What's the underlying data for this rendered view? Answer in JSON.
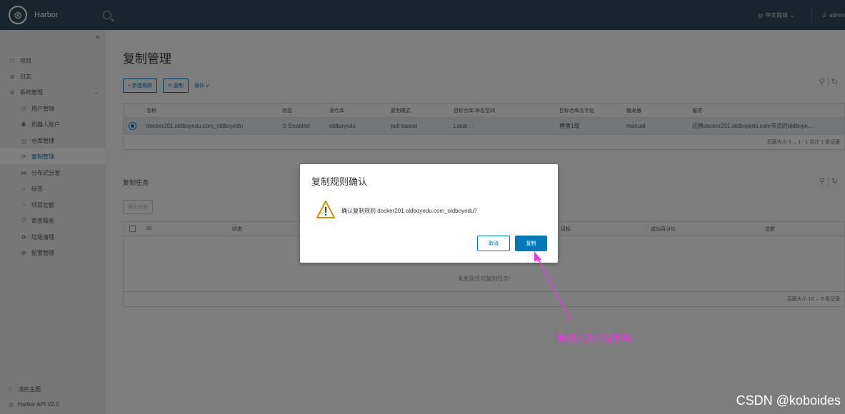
{
  "header": {
    "app_name": "Harbor",
    "language": "中文简体 ⌄",
    "user": "admin"
  },
  "sidebar": {
    "collapse": "«",
    "items": [
      {
        "label": "项目",
        "icon": "⚇"
      },
      {
        "label": "日志",
        "icon": "≣"
      },
      {
        "label": "系统管理",
        "icon": "⚙"
      },
      {
        "label": "用户管理",
        "icon": "⚇"
      },
      {
        "label": "机器人账户",
        "icon": "⚉"
      },
      {
        "label": "仓库管理",
        "icon": "◫"
      },
      {
        "label": "复制管理",
        "icon": "⟳"
      },
      {
        "label": "分布式分发",
        "icon": "⋈"
      },
      {
        "label": "标签",
        "icon": "⌂"
      },
      {
        "label": "项目定额",
        "icon": "◔"
      },
      {
        "label": "审查服务",
        "icon": "⛉"
      },
      {
        "label": "垃圾清理",
        "icon": "♻"
      },
      {
        "label": "配置管理",
        "icon": "⚙"
      }
    ],
    "theme": "浅色主题",
    "api": "Harbor API V2.0"
  },
  "main": {
    "title": "复制管理",
    "new_rule": "+ 新建规则",
    "replicate": "⟳ 复制",
    "ops": "操作 ∨",
    "rules_table": {
      "columns": [
        "名称",
        "状态",
        "源仓库",
        "复制模式",
        "目标仓库:命名空间",
        "目标仓库名字化",
        "触发器",
        "描述"
      ],
      "row": [
        "docker201.oldboyedu.com_oldboyedu",
        "⊙ Enabled",
        "oldboyedu",
        "pull-based",
        "Local : -",
        "替换1级",
        "manual",
        "迁移docker201.oldboyedu.com节点的oldboye…"
      ],
      "footer": "页面大小  5  ⌄     1 - 1 共计 1 条记录"
    },
    "tasks_title": "复制任务",
    "stop_task": "停止任务",
    "tasks_table": {
      "columns": [
        "ID",
        "状态",
        "目标",
        "成功百分比",
        "总数"
      ],
      "empty": "未发现任何复制任务!",
      "footer": "页面大小  15  ⌄     0 条记录"
    }
  },
  "modal": {
    "title": "复制规则确认",
    "message": "确认复制规则 docker201.oldboyedu.com_oldboyedu?",
    "cancel": "取消",
    "confirm": "复制"
  },
  "annotation": "要确认执行规则哟~",
  "watermark": "CSDN @koboides",
  "colors": {
    "header": "#2f4d5c",
    "accent": "#0079b8",
    "annotation": "#e83ce0",
    "warning": "#d28f00"
  }
}
